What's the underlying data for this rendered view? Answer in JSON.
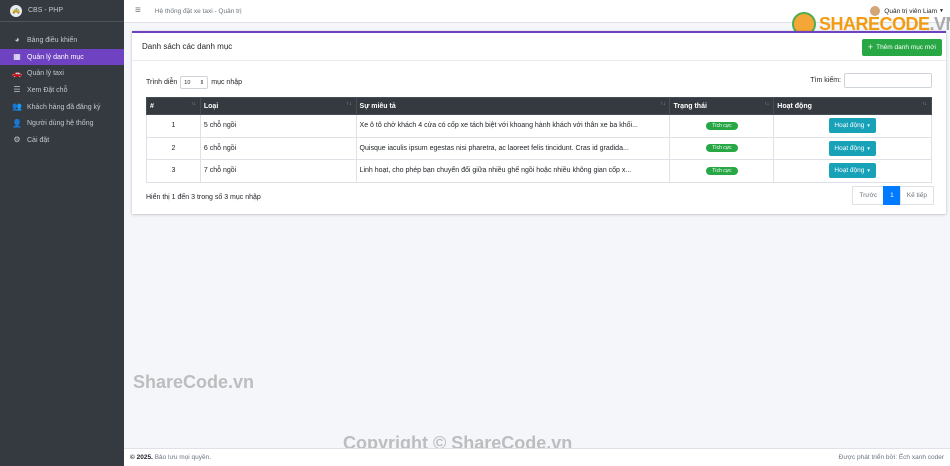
{
  "brand": {
    "name": "CBS - PHP"
  },
  "sidebar": {
    "items": [
      {
        "label": "Bảng điều khiển",
        "icon": "dashboard-icon",
        "active": false
      },
      {
        "label": "Quản lý danh mục",
        "icon": "grid-icon",
        "active": true
      },
      {
        "label": "Quản lý taxi",
        "icon": "car-icon",
        "active": false
      },
      {
        "label": "Xem Đặt chỗ",
        "icon": "list-icon",
        "active": false
      },
      {
        "label": "Khách hàng đã đăng ký",
        "icon": "users-icon",
        "active": false
      },
      {
        "label": "Người dùng hệ thống",
        "icon": "user-group-icon",
        "active": false
      },
      {
        "label": "Cài đặt",
        "icon": "gears-icon",
        "active": false
      }
    ]
  },
  "navbar": {
    "breadcrumb": "Hệ thống đặt xe taxi - Quản trị",
    "user_name": "Quản trị viên Liam"
  },
  "card": {
    "title": "Danh sách các danh mục",
    "add_button": "Thêm danh mục mới"
  },
  "controls": {
    "show_prefix": "Trình diễn",
    "show_value": "10",
    "show_suffix": "mục nhập",
    "search_label": "Tìm kiếm:"
  },
  "table": {
    "headers": [
      "#",
      "Loại",
      "Sự miêu tả",
      "Trạng thái",
      "Hoạt động"
    ],
    "rows": [
      {
        "num": "1",
        "type": "5 chỗ ngồi",
        "desc": "Xe ô tô chở khách 4 cửa có cốp xe tách biệt với khoang hành khách với thân xe ba khối...",
        "status": "Tích cực",
        "action": "Hoạt động"
      },
      {
        "num": "2",
        "type": "6 chỗ ngồi",
        "desc": "Quisque iaculis ipsum egestas nisi pharetra, ac laoreet felis tincidunt. Cras id gradida...",
        "status": "Tích cực",
        "action": "Hoạt động"
      },
      {
        "num": "3",
        "type": "7 chỗ ngồi",
        "desc": "Linh hoạt, cho phép bạn chuyển đổi giữa nhiều ghế ngồi hoặc nhiều không gian cốp x...",
        "status": "Tích cực",
        "action": "Hoạt động"
      }
    ]
  },
  "footer_table": {
    "info": "Hiển thị 1 đến 3 trong số 3 mục nhập",
    "prev": "Trước",
    "page": "1",
    "next": "Kế tiếp"
  },
  "footer": {
    "year": "© 2025.",
    "rights": "Bảo lưu mọi quyền.",
    "dev": "Được phát triển bởi: Ếch xanh coder"
  },
  "watermarks": {
    "logo_main": "SHARECODE",
    "logo_dot": ".VN",
    "text1": "ShareCode.vn",
    "text2": "Copyright © ShareCode.vn"
  },
  "colors": {
    "sidebar_bg": "#343a40",
    "accent": "#6f42c1",
    "success": "#28a745",
    "info": "#17a2b8",
    "primary": "#007bff"
  }
}
